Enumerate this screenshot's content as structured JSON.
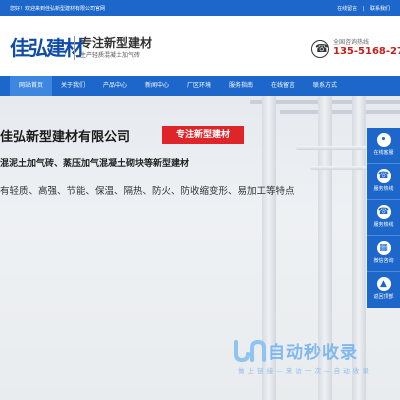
{
  "topbar": {
    "welcome": "您好！欢迎来到佳弘新型建材有限公司官网",
    "links": [
      "在线留言",
      "联系我们"
    ]
  },
  "header": {
    "logo_text": "佳弘建材",
    "slogan_main": "专注新型建材",
    "slogan_sub": "生产轻质混凝土加气砖",
    "hotline_label": "全国咨询热线",
    "hotline_number": "135-5168-2768",
    "icon": "phone-icon"
  },
  "nav": {
    "items": [
      {
        "label": "网站首页",
        "active": true
      },
      {
        "label": "关于我们",
        "active": false
      },
      {
        "label": "产品中心",
        "active": false
      },
      {
        "label": "新闻中心",
        "active": false
      },
      {
        "label": "厂区环境",
        "active": false
      },
      {
        "label": "服务指南",
        "active": false
      },
      {
        "label": "在线留言",
        "active": false
      },
      {
        "label": "联系方式",
        "active": false
      }
    ]
  },
  "banner": {
    "company": "佳弘新型建材有限公司",
    "badge": "专注新型建材",
    "line1": "混泥土加气砖、蒸压加气混凝土砌块等新型建材",
    "line2": "有轻质、高强、节能、保温、隔热、防火、防收缩变形、易加工等特点"
  },
  "side": {
    "items": [
      {
        "label": "在线客服",
        "icon": "chat-icon"
      },
      {
        "label": "服务热线",
        "icon": "phone-icon"
      },
      {
        "label": "服务热线",
        "icon": "phone-icon"
      },
      {
        "label": "微信咨询",
        "icon": "qrcode-icon"
      },
      {
        "label": "返回顶部",
        "icon": "arrow-up-icon"
      }
    ]
  },
  "watermark": {
    "title": "自动秒收录",
    "subtitle": "做 上 链 接 — 来 访 一 次 — 自 动 收 录"
  },
  "colors": {
    "primary": "#1c67c9",
    "accent": "#e0252a",
    "hotline": "#c2201b"
  }
}
